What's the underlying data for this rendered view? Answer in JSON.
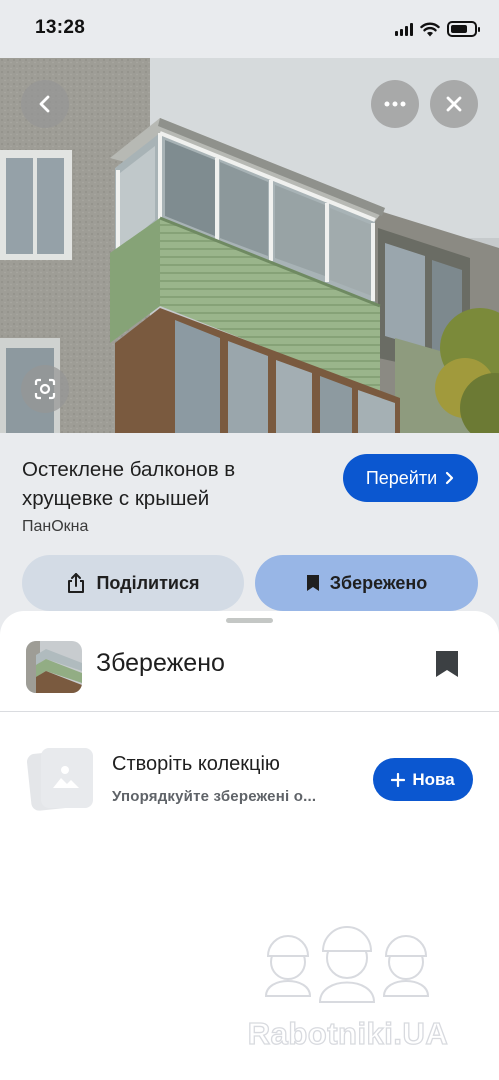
{
  "status_bar": {
    "time": "13:28"
  },
  "result": {
    "title": "Остеклене балконов в хрущевке с крышей",
    "source": "ПанОкна",
    "visit_label": "Перейти"
  },
  "actions": {
    "share_label": "Поділитися",
    "saved_label": "Збережено"
  },
  "sheet": {
    "title": "Збережено",
    "collection_title": "Створіть колекцію",
    "collection_subtitle": "Упорядкуйте збережені о...",
    "new_label": "Нова"
  },
  "watermark": {
    "text": "Rabotniki.UA"
  },
  "colors": {
    "accent": "#0b57d0",
    "saved_pill": "#98b6e6",
    "share_pill": "#d3dbe5",
    "background": "#e9ebee"
  },
  "icons": {
    "back": "arrow-left-icon",
    "more": "more-horizontal-icon",
    "close": "close-icon",
    "lens": "lens-icon",
    "share": "share-icon",
    "bookmark": "bookmark-icon",
    "plus": "plus-icon",
    "chevron": "chevron-right-icon"
  }
}
